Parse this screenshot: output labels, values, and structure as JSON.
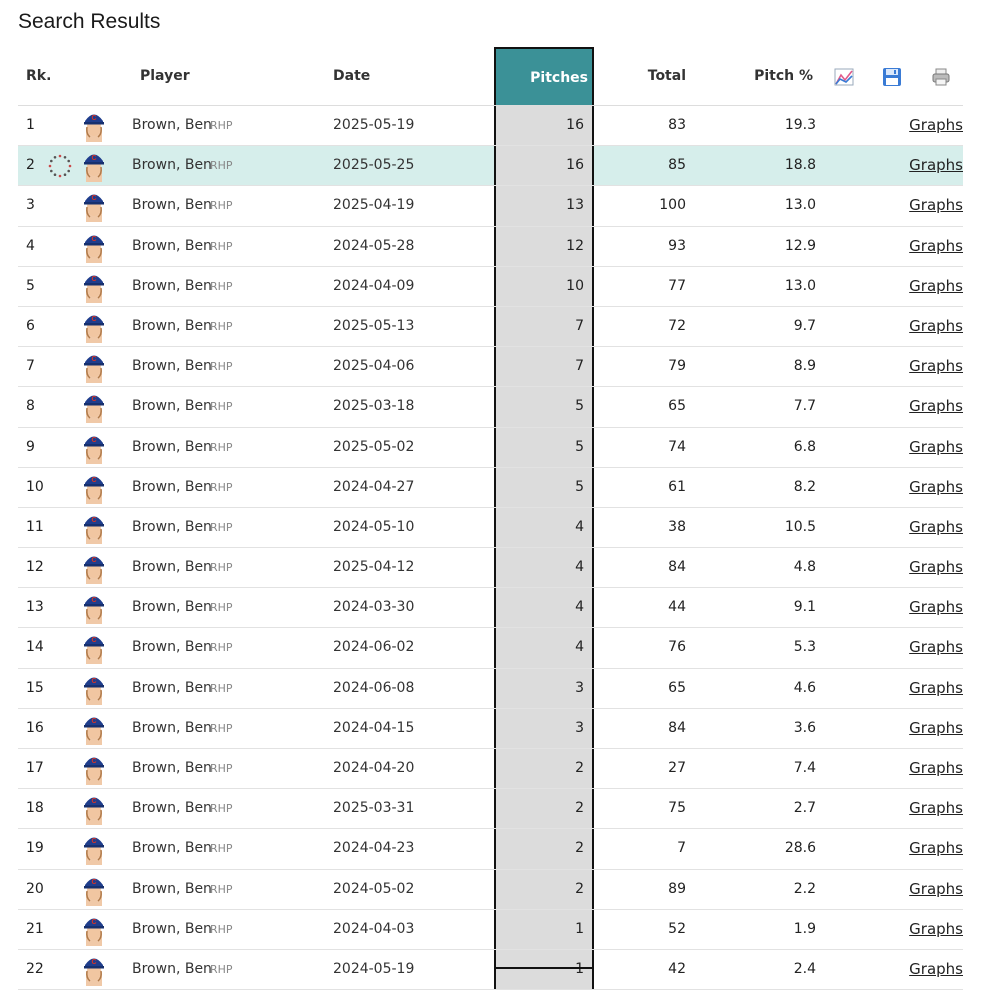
{
  "page": {
    "title": "Search Results"
  },
  "columns": {
    "rank": "Rk.",
    "player": "Player",
    "date": "Date",
    "pitches": "Pitches",
    "total": "Total",
    "pitch_pct": "Pitch %"
  },
  "header_icons": [
    "chart-icon",
    "save-icon",
    "print-icon"
  ],
  "colors": {
    "accent": "#3b9197",
    "highlight_row": "#d6eeeb",
    "pitches_column": "#dcdcdc"
  },
  "link_label": "Graphs",
  "highlighted_row": 2,
  "rows": [
    {
      "rank": "1",
      "player": "Brown, Ben",
      "hand": "RHP",
      "date": "2025-05-19",
      "pitches": "16",
      "total": "83",
      "pct": "19.3"
    },
    {
      "rank": "2",
      "player": "Brown, Ben",
      "hand": "RHP",
      "date": "2025-05-25",
      "pitches": "16",
      "total": "85",
      "pct": "18.8"
    },
    {
      "rank": "3",
      "player": "Brown, Ben",
      "hand": "RHP",
      "date": "2025-04-19",
      "pitches": "13",
      "total": "100",
      "pct": "13.0"
    },
    {
      "rank": "4",
      "player": "Brown, Ben",
      "hand": "RHP",
      "date": "2024-05-28",
      "pitches": "12",
      "total": "93",
      "pct": "12.9"
    },
    {
      "rank": "5",
      "player": "Brown, Ben",
      "hand": "RHP",
      "date": "2024-04-09",
      "pitches": "10",
      "total": "77",
      "pct": "13.0"
    },
    {
      "rank": "6",
      "player": "Brown, Ben",
      "hand": "RHP",
      "date": "2025-05-13",
      "pitches": "7",
      "total": "72",
      "pct": "9.7"
    },
    {
      "rank": "7",
      "player": "Brown, Ben",
      "hand": "RHP",
      "date": "2025-04-06",
      "pitches": "7",
      "total": "79",
      "pct": "8.9"
    },
    {
      "rank": "8",
      "player": "Brown, Ben",
      "hand": "RHP",
      "date": "2025-03-18",
      "pitches": "5",
      "total": "65",
      "pct": "7.7"
    },
    {
      "rank": "9",
      "player": "Brown, Ben",
      "hand": "RHP",
      "date": "2025-05-02",
      "pitches": "5",
      "total": "74",
      "pct": "6.8"
    },
    {
      "rank": "10",
      "player": "Brown, Ben",
      "hand": "RHP",
      "date": "2024-04-27",
      "pitches": "5",
      "total": "61",
      "pct": "8.2"
    },
    {
      "rank": "11",
      "player": "Brown, Ben",
      "hand": "RHP",
      "date": "2024-05-10",
      "pitches": "4",
      "total": "38",
      "pct": "10.5"
    },
    {
      "rank": "12",
      "player": "Brown, Ben",
      "hand": "RHP",
      "date": "2025-04-12",
      "pitches": "4",
      "total": "84",
      "pct": "4.8"
    },
    {
      "rank": "13",
      "player": "Brown, Ben",
      "hand": "RHP",
      "date": "2024-03-30",
      "pitches": "4",
      "total": "44",
      "pct": "9.1"
    },
    {
      "rank": "14",
      "player": "Brown, Ben",
      "hand": "RHP",
      "date": "2024-06-02",
      "pitches": "4",
      "total": "76",
      "pct": "5.3"
    },
    {
      "rank": "15",
      "player": "Brown, Ben",
      "hand": "RHP",
      "date": "2024-06-08",
      "pitches": "3",
      "total": "65",
      "pct": "4.6"
    },
    {
      "rank": "16",
      "player": "Brown, Ben",
      "hand": "RHP",
      "date": "2024-04-15",
      "pitches": "3",
      "total": "84",
      "pct": "3.6"
    },
    {
      "rank": "17",
      "player": "Brown, Ben",
      "hand": "RHP",
      "date": "2024-04-20",
      "pitches": "2",
      "total": "27",
      "pct": "7.4"
    },
    {
      "rank": "18",
      "player": "Brown, Ben",
      "hand": "RHP",
      "date": "2025-03-31",
      "pitches": "2",
      "total": "75",
      "pct": "2.7"
    },
    {
      "rank": "19",
      "player": "Brown, Ben",
      "hand": "RHP",
      "date": "2024-04-23",
      "pitches": "2",
      "total": "7",
      "pct": "28.6"
    },
    {
      "rank": "20",
      "player": "Brown, Ben",
      "hand": "RHP",
      "date": "2024-05-02",
      "pitches": "2",
      "total": "89",
      "pct": "2.2"
    },
    {
      "rank": "21",
      "player": "Brown, Ben",
      "hand": "RHP",
      "date": "2024-04-03",
      "pitches": "1",
      "total": "52",
      "pct": "1.9"
    },
    {
      "rank": "22",
      "player": "Brown, Ben",
      "hand": "RHP",
      "date": "2024-05-19",
      "pitches": "1",
      "total": "42",
      "pct": "2.4"
    }
  ]
}
